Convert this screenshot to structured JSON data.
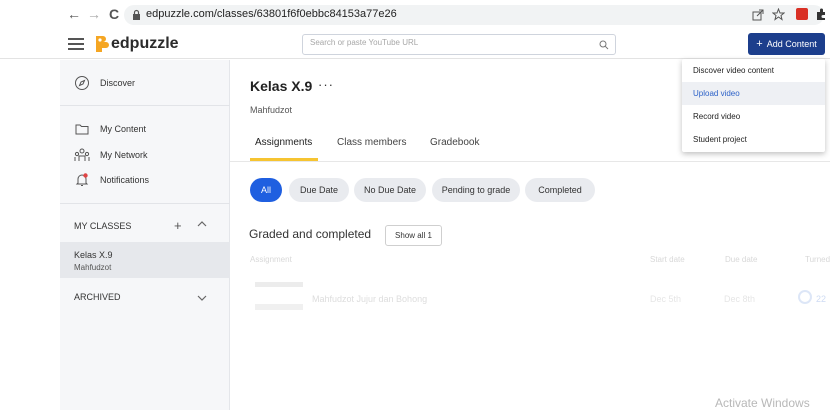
{
  "browser": {
    "back": "←",
    "forward": "→",
    "reload": "C",
    "url": "edpuzzle.com/classes/63801f6f0ebbc84153a77e26"
  },
  "header": {
    "logo_text": "edpuzzle",
    "search_placeholder": "Search or paste YouTube URL",
    "add_content_label": "Add Content",
    "add_content_plus": "+"
  },
  "sidebar": {
    "items": [
      {
        "label": "Discover",
        "icon": "compass-icon"
      },
      {
        "label": "My Content",
        "icon": "folder-icon"
      },
      {
        "label": "My Network",
        "icon": "network-icon"
      },
      {
        "label": "Notifications",
        "icon": "bell-icon"
      }
    ],
    "my_classes_label": "MY CLASSES",
    "add_class": "+",
    "class": {
      "name": "Kelas X.9",
      "teacher": "Mahfudzot"
    },
    "archived_label": "ARCHIVED"
  },
  "main": {
    "class_title": "Kelas X.9",
    "more": "···",
    "teacher": "Mahfudzot",
    "tabs": [
      {
        "label": "Assignments",
        "active": true
      },
      {
        "label": "Class members",
        "active": false
      },
      {
        "label": "Gradebook",
        "active": false
      }
    ],
    "filters": [
      {
        "label": "All",
        "active": true
      },
      {
        "label": "Due Date",
        "active": false
      },
      {
        "label": "No Due Date",
        "active": false
      },
      {
        "label": "Pending to grade",
        "active": false
      },
      {
        "label": "Completed",
        "active": false
      }
    ],
    "section_title": "Graded and completed",
    "show_all_label": "Show all 1",
    "columns": [
      "Assignment",
      "Start date",
      "Due date",
      "Turned"
    ],
    "row": {
      "title": "Mahfudzot Jujur dan Bohong",
      "start": "Dec 5th",
      "due": "Dec 8th",
      "turned": "22"
    }
  },
  "dropdown": {
    "items": [
      {
        "label": "Discover video content",
        "active": false
      },
      {
        "label": "Upload video",
        "active": true
      },
      {
        "label": "Record video",
        "active": false
      },
      {
        "label": "Student project",
        "active": false
      }
    ]
  },
  "watermark": "Activate Windows",
  "colors": {
    "brand_blue": "#1c3e8c",
    "chip_active": "#1f5fe0",
    "tab_underline": "#f6c431",
    "link_blue": "#2d62c8"
  }
}
